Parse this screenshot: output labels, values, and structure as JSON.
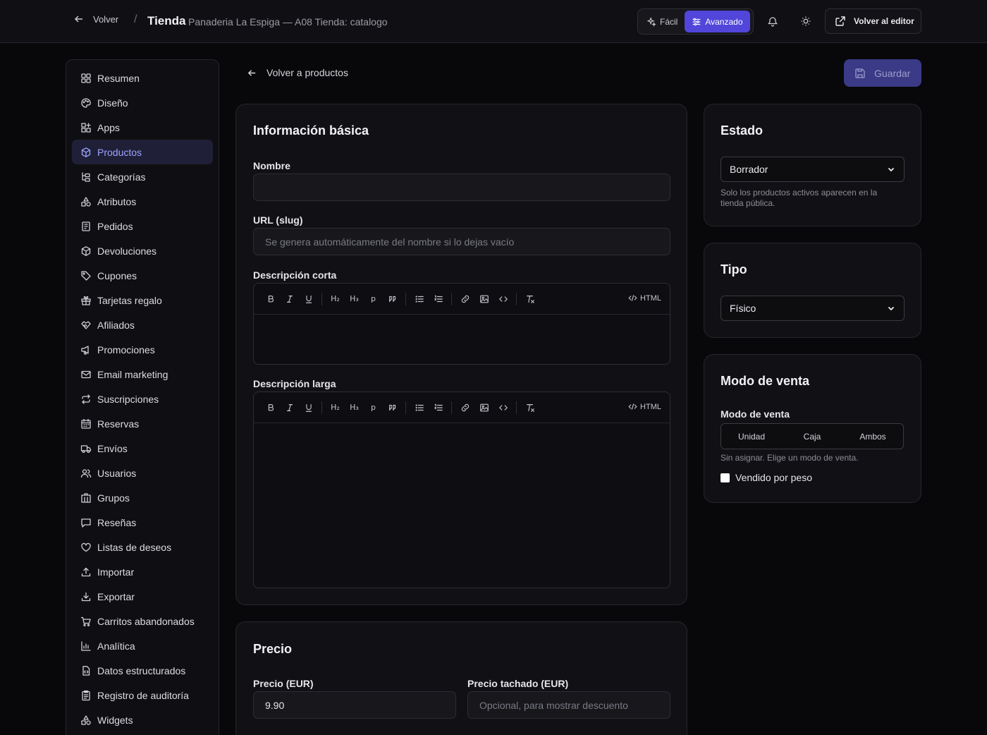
{
  "header": {
    "back_label": "Volver",
    "separator": "/",
    "title": "Tienda",
    "subtitle": "Panaderia La Espiga — A08 Tienda: catalogo",
    "mode_easy": "Fácil",
    "mode_advanced": "Avanzado",
    "editor_label": "Volver al editor"
  },
  "sidebar": {
    "items": [
      {
        "label": "Resumen",
        "icon": "dashboard-icon"
      },
      {
        "label": "Diseño",
        "icon": "palette-icon"
      },
      {
        "label": "Apps",
        "icon": "apps-icon"
      },
      {
        "label": "Productos",
        "icon": "package-icon",
        "active": true
      },
      {
        "label": "Categorías",
        "icon": "folder-tree-icon"
      },
      {
        "label": "Atributos",
        "icon": "shapes-icon"
      },
      {
        "label": "Pedidos",
        "icon": "receipt-icon"
      },
      {
        "label": "Devoluciones",
        "icon": "package-return-icon"
      },
      {
        "label": "Cupones",
        "icon": "tag-icon"
      },
      {
        "label": "Tarjetas regalo",
        "icon": "gift-icon"
      },
      {
        "label": "Afiliados",
        "icon": "handshake-icon"
      },
      {
        "label": "Promociones",
        "icon": "megaphone-icon"
      },
      {
        "label": "Email marketing",
        "icon": "mail-icon"
      },
      {
        "label": "Suscripciones",
        "icon": "repeat-icon"
      },
      {
        "label": "Reservas",
        "icon": "calendar-icon"
      },
      {
        "label": "Envíos",
        "icon": "truck-icon"
      },
      {
        "label": "Usuarios",
        "icon": "users-icon"
      },
      {
        "label": "Grupos",
        "icon": "building-icon"
      },
      {
        "label": "Reseñas",
        "icon": "message-icon"
      },
      {
        "label": "Listas de deseos",
        "icon": "heart-icon"
      },
      {
        "label": "Importar",
        "icon": "upload-icon"
      },
      {
        "label": "Exportar",
        "icon": "download-icon"
      },
      {
        "label": "Carritos abandonados",
        "icon": "cart-icon"
      },
      {
        "label": "Analítica",
        "icon": "bar-chart-icon"
      },
      {
        "label": "Datos estructurados",
        "icon": "file-code-icon"
      },
      {
        "label": "Registro de auditoría",
        "icon": "clipboard-icon"
      },
      {
        "label": "Widgets",
        "icon": "shapes-icon"
      }
    ]
  },
  "main": {
    "back_label": "Volver a productos",
    "save_label": "Guardar",
    "basic": {
      "title": "Información básica",
      "name_label": "Nombre",
      "name_value": "",
      "slug_label": "URL (slug)",
      "slug_placeholder": "Se genera automáticamente del nombre si lo dejas vacío",
      "short_desc_label": "Descripción corta",
      "long_desc_label": "Descripción larga",
      "html_label": "HTML"
    },
    "price": {
      "title": "Precio",
      "price_label": "Precio (EUR)",
      "price_value": "9.90",
      "compare_label": "Precio tachado (EUR)",
      "compare_placeholder": "Opcional, para mostrar descuento"
    }
  },
  "status": {
    "title": "Estado",
    "selected": "Borrador",
    "hint": "Solo los productos activos aparecen en la tienda pública."
  },
  "type": {
    "title": "Tipo",
    "selected": "Físico"
  },
  "sale_mode": {
    "title": "Modo de venta",
    "label": "Modo de venta",
    "options": [
      "Unidad",
      "Caja",
      "Ambos"
    ],
    "hint": "Sin asignar. Elige un modo de venta.",
    "weight_label": "Vendido por peso",
    "weight_checked": false
  }
}
